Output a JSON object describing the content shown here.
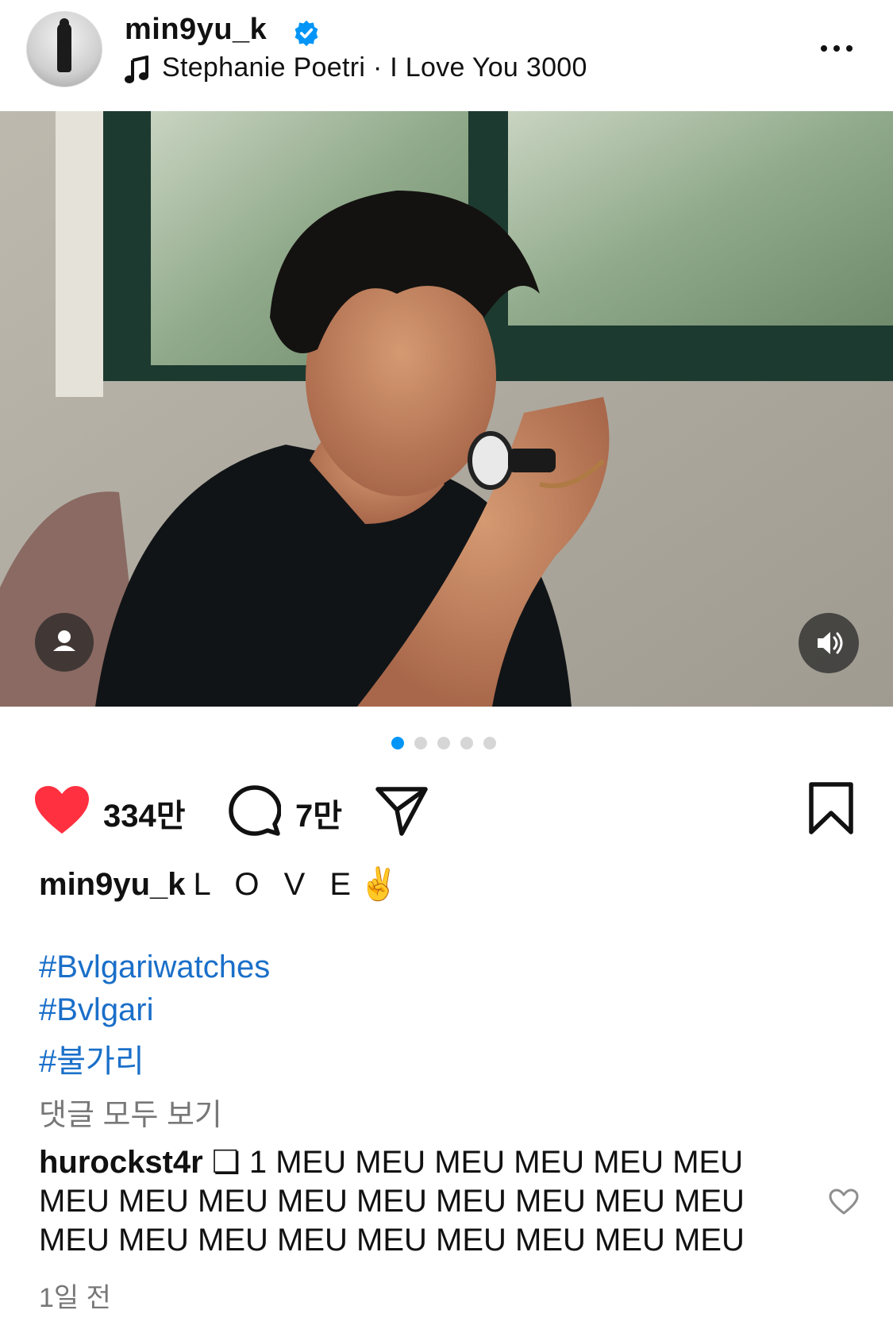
{
  "header": {
    "username": "min9yu_k",
    "music": "Stephanie Poetri · I Love You 3000"
  },
  "carousel": {
    "count": 5,
    "active": 1
  },
  "actions": {
    "likes": "334만",
    "comments": "7만"
  },
  "caption": {
    "username": "min9yu_k",
    "text": "L O V E",
    "emoji": "✌️",
    "hashtags": [
      "#Bvlgariwatches",
      "#Bvlgari",
      "#불가리"
    ]
  },
  "view_all_comments": "댓글 모두 보기",
  "top_comment": {
    "username": "hurockst4r",
    "text": "❏ 1 MEU MEU MEU MEU MEU MEU MEU MEU MEU MEU MEU MEU MEU MEU MEU MEU MEU MEU MEU MEU MEU MEU MEU MEU"
  },
  "time_ago": "1일 전",
  "colors": {
    "accent": "#0095f6",
    "like": "#ff3040",
    "hashtag": "#1a6fc9"
  },
  "icons": [
    "verified-badge-icon",
    "music-note-icon",
    "more-icon",
    "user-tag-icon",
    "sound-icon",
    "heart-icon",
    "comment-icon",
    "share-icon",
    "save-icon"
  ]
}
